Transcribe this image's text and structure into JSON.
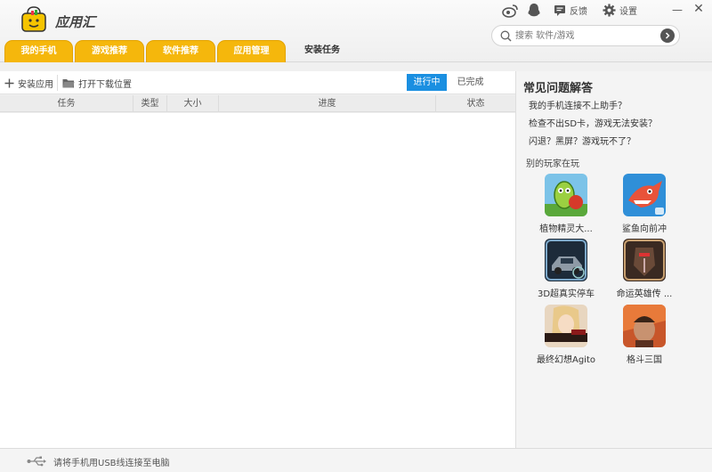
{
  "app": {
    "name": "应用汇"
  },
  "header": {
    "feedback_label": "反馈",
    "settings_label": "设置",
    "search": {
      "placeholder": "搜索 软件/游戏"
    }
  },
  "tabs": [
    {
      "label": "我的手机"
    },
    {
      "label": "游戏推荐"
    },
    {
      "label": "软件推荐"
    },
    {
      "label": "应用管理"
    },
    {
      "label": "安装任务",
      "active": true
    }
  ],
  "toolbar": {
    "install_label": "安装应用",
    "open_folder_label": "打开下载位置",
    "in_progress_label": "进行中",
    "completed_label": "已完成"
  },
  "table": {
    "columns": [
      "任务",
      "类型",
      "大小",
      "进度",
      "状态"
    ]
  },
  "faq": {
    "title": "常见问题解答",
    "items": [
      "我的手机连接不上助手？",
      "检查不出SD卡，游戏无法安装？",
      "闪退？黑屏？游戏玩不了？"
    ]
  },
  "others": {
    "title": "别的玩家在玩",
    "games": [
      {
        "name": "植物精灵大..."
      },
      {
        "name": "鲨鱼向前冲"
      },
      {
        "name": "3D超真实停车"
      },
      {
        "name": "命运英雄传 ..."
      },
      {
        "name": "最终幻想Agito"
      },
      {
        "name": "格斗三国"
      }
    ]
  },
  "status": {
    "text": "请将手机用USB线连接至电脑"
  },
  "colors": {
    "tab_yellow": "#f5b70c",
    "accent_blue": "#1a8fe1"
  }
}
